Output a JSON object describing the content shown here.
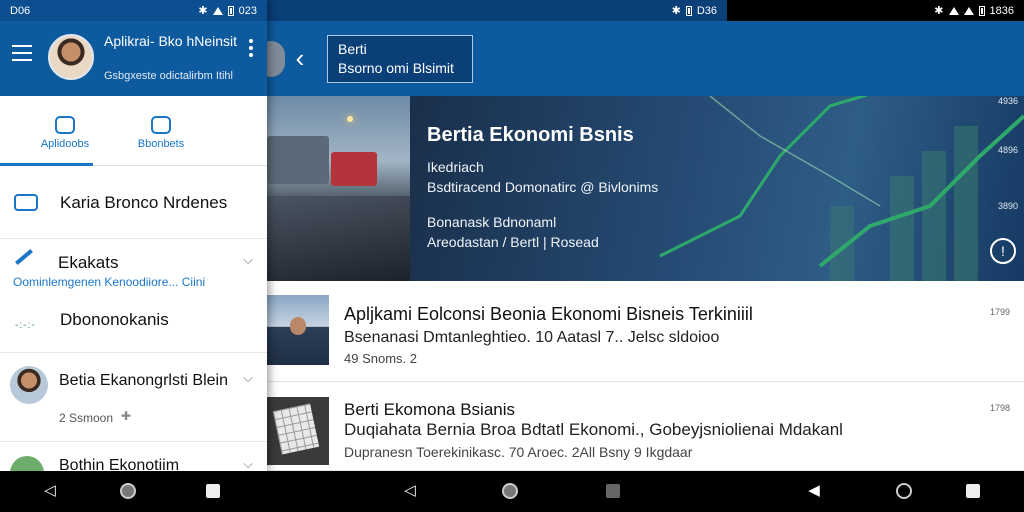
{
  "status": {
    "left_time": "D06",
    "mid_time": "D36",
    "left_right_time": "023",
    "right_time": "1836"
  },
  "drawer": {
    "user_name": "Aplikrai- Bko hNeinsit",
    "user_email": "Gsbgxeste odictalirbm Itihl",
    "tabs": [
      {
        "label": "Aplidoobs",
        "icon": "camera-icon"
      },
      {
        "label": "Bbonbets",
        "icon": "tv-icon"
      }
    ],
    "items": [
      {
        "label": "Karia Bronco Nrdenes",
        "icon": "folder-icon"
      },
      {
        "label": "Ekakats",
        "sub": "Oominlemgenen Kenoodiiore... Ciini",
        "icon": "pencil-icon"
      },
      {
        "label": "Dbononokanis",
        "icon": "dots-icon"
      },
      {
        "label": "Betia Ekanongrlsti Blein",
        "meta": "2 Ssmoon",
        "icon": "avatar"
      },
      {
        "label": "Bothin Ekonotiim",
        "icon": "avatar"
      }
    ]
  },
  "header": {
    "title_line1": "Berti",
    "title_line2": "Bsorno omi Blsimit"
  },
  "hero": {
    "title": "Bertia  Ekonomi Bsnis",
    "line1": "Ikedriach",
    "line2": "Bsdtiracend Domonatirc @ Bivlonims",
    "line3": "Bonanask Bdnonaml",
    "line4": "Areodastan / Bertl | Rosead",
    "tick1": "4936",
    "tick2": "4896",
    "tick3": "3890",
    "info_icon": "info-icon"
  },
  "news": [
    {
      "title": "Apljkami Eolconsi Beonia Ekonomi Bisneis Terkiniiil",
      "sub": "Bsenanasi Dmtanleghtieo. 10 Aatasl 7.. Jelsc sldoioo",
      "meta": "49 Snoms. 2",
      "corner": "1799"
    },
    {
      "title": "Berti Ekomona Bsianis",
      "sub": "Duqiahata Bernia Broa Bdtatl Ekonomi., Gobeyjsniolienai Mdakanl",
      "meta": "Dupranesn Toerekinikasc. 70 Aroec. 2All Bsny 9 Ikgdaar",
      "corner": "1798"
    }
  ],
  "colors": {
    "brand": "#0d5a9e",
    "accent": "#1976c7",
    "chart_line": "#2fa86b"
  }
}
